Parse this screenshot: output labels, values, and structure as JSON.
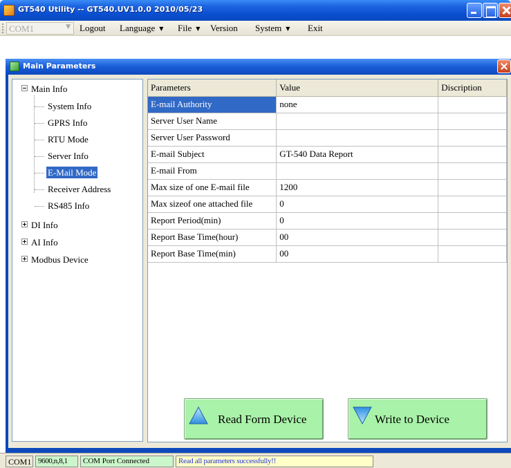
{
  "window": {
    "title": "GT540 Utility -- GT540.UV1.0.0 2010/05/23"
  },
  "toolbar": {
    "port_value": "COM1",
    "menus": [
      "Logout",
      "Language",
      "File",
      "Version",
      "System",
      "Exit"
    ]
  },
  "child_window": {
    "title": "Main Parameters"
  },
  "tree": {
    "main_info": "Main Info",
    "system_info": "System Info",
    "gprs_info": "GPRS Info",
    "rtu_mode": "RTU Mode",
    "server_info": "Server Info",
    "email_mode": "E-Mail Mode",
    "receiver_address": "Receiver Address",
    "rs485_info": "RS485 Info",
    "di_info": "DI Info",
    "ai_info": "AI Info",
    "modbus_device": "Modbus Device"
  },
  "grid": {
    "headers": {
      "parameters": "Parameters",
      "value": "Value",
      "description": "Discription"
    },
    "rows": [
      {
        "param": "E-mail Authority",
        "value": "none",
        "desc": ""
      },
      {
        "param": "Server User Name",
        "value": "",
        "desc": ""
      },
      {
        "param": "Server User Password",
        "value": "",
        "desc": ""
      },
      {
        "param": "E-mail Subject",
        "value": "GT-540 Data Report",
        "desc": ""
      },
      {
        "param": "E-mail From",
        "value": "",
        "desc": ""
      },
      {
        "param": "Max size of one E-mail file",
        "value": "1200",
        "desc": ""
      },
      {
        "param": "Max sizeof one attached file",
        "value": "0",
        "desc": ""
      },
      {
        "param": "Report Period(min)",
        "value": "0",
        "desc": ""
      },
      {
        "param": "Report Base Time(hour)",
        "value": "00",
        "desc": ""
      },
      {
        "param": "Report Base Time(min)",
        "value": "00",
        "desc": ""
      }
    ]
  },
  "buttons": {
    "read_label": "Read Form Device",
    "write_label": "Write to Device"
  },
  "status": {
    "port": "COM1",
    "settings": "9600,n,8,1",
    "connection": "COM Port Connected",
    "message": "Read all parameters successfully!!"
  },
  "colors": {
    "selection": "#3169c6",
    "button_green": "#a9f2a9",
    "titlebar_blue": "#0b49bc",
    "status_message": "#2a38d6"
  }
}
